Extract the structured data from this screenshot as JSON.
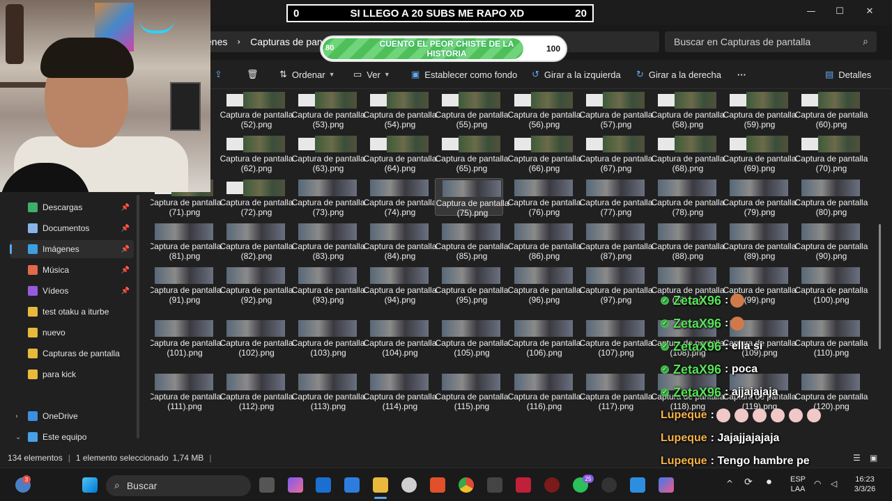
{
  "stream": {
    "goal_left": "0",
    "goal_text": "SI LLEGO A 20 SUBS ME RAPO XD",
    "goal_right": "20",
    "progress_start": "80",
    "progress_title": "CUENTO EL PEOR CHISTE DE LA HISTORIA",
    "progress_end": "100",
    "progress_fraction": 0.82,
    "chat": [
      {
        "user": "ZetaX96",
        "text": ":",
        "emote": true
      },
      {
        "user": "ZetaX96",
        "text": ":",
        "emote": true
      },
      {
        "user": "ZetaX96",
        "text": ": ella si",
        "emote": false
      },
      {
        "user": "ZetaX96",
        "text": ": poca",
        "emote": false
      },
      {
        "user": "ZetaX96",
        "text": ": ajjajajaja",
        "emote": false
      },
      {
        "user": "Lupeque",
        "text": ":",
        "emote": true
      },
      {
        "user": "Lupeque",
        "text": ": Jajajjajajaja",
        "emote": false
      },
      {
        "user": "Lupeque",
        "text": ": Tengo hambre pe",
        "emote": false
      }
    ]
  },
  "explorer": {
    "breadcrumb_prev": "enes",
    "breadcrumb_current": "Capturas de pan",
    "search_placeholder": "Buscar en Capturas de pantalla",
    "toolbar": {
      "sort": "Ordenar",
      "view": "Ver",
      "set_background": "Establecer como fondo",
      "rotate_left": "Girar a la izquierda",
      "rotate_right": "Girar a la derecha",
      "more": "···",
      "details": "Detalles"
    },
    "sidebar": [
      {
        "label": "Descargas",
        "pinned": true,
        "color": "#3fae6a"
      },
      {
        "label": "Documentos",
        "pinned": true,
        "color": "#8ab4e8"
      },
      {
        "label": "Imágenes",
        "pinned": true,
        "color": "#3d9ee0"
      },
      {
        "label": "Música",
        "pinned": true,
        "color": "#e06a4a"
      },
      {
        "label": "Vídeos",
        "pinned": true,
        "color": "#9a5ae0"
      },
      {
        "label": "test otaku a iturbe",
        "pinned": false,
        "color": "#e8b93c"
      },
      {
        "label": "nuevo",
        "pinned": false,
        "color": "#e8b93c"
      },
      {
        "label": "Capturas de pantalla",
        "pinned": false,
        "color": "#e8b93c"
      },
      {
        "label": "para kick",
        "pinned": false,
        "color": "#e8b93c"
      },
      {
        "label": "OneDrive",
        "pinned": false,
        "color": "#3d8ee0"
      },
      {
        "label": "Este equipo",
        "pinned": false,
        "color": "#4aa0e8"
      }
    ],
    "files": [
      "Captura de pantalla (52).png",
      "Captura de pantalla (53).png",
      "Captura de pantalla (54).png",
      "Captura de pantalla (55).png",
      "Captura de pantalla (56).png",
      "Captura de pantalla (57).png",
      "Captura de pantalla (58).png",
      "Captura de pantalla (59).png",
      "Captura de pantalla (60).png",
      "Captura de pantalla (62).png",
      "Captura de pantalla (63).png",
      "Captura de pantalla (64).png",
      "Captura de pantalla (65).png",
      "Captura de pantalla (66).png",
      "Captura de pantalla (67).png",
      "Captura de pantalla (68).png",
      "Captura de pantalla (69).png",
      "Captura de pantalla (70).png",
      "Captura de pantalla (71).png",
      "Captura de pantalla (72).png",
      "Captura de pantalla (73).png",
      "Captura de pantalla (74).png",
      "Captura de pantalla (75).png",
      "Captura de pantalla (76).png",
      "Captura de pantalla (77).png",
      "Captura de pantalla (78).png",
      "Captura de pantalla (79).png",
      "Captura de pantalla (80).png",
      "Captura de pantalla (81).png",
      "Captura de pantalla (82).png",
      "Captura de pantalla (83).png",
      "Captura de pantalla (84).png",
      "Captura de pantalla (85).png",
      "Captura de pantalla (86).png",
      "Captura de pantalla (87).png",
      "Captura de pantalla (88).png",
      "Captura de pantalla (89).png",
      "Captura de pantalla (90).png",
      "Captura de pantalla (91).png",
      "Captura de pantalla (92).png",
      "Captura de pantalla (93).png",
      "Captura de pantalla (94).png",
      "Captura de pantalla (95).png",
      "Captura de pantalla (96).png",
      "Captura de pantalla (97).png",
      "Captura de pantalla (98).png",
      "Captura de pantalla (99).png",
      "Captura de pantalla (100).png",
      "Captura de pantalla (101).png",
      "Captura de pantalla (102).png",
      "Captura de pantalla (103).png",
      "Captura de pantalla (104).png",
      "Captura de pantalla (105).png",
      "Captura de pantalla (106).png",
      "Captura de pantalla (107).png",
      "Captura de pantalla (108).png",
      "Captura de pantalla (109).png",
      "Captura de pantalla (110).png",
      "Captura de pantalla (111).png",
      "Captura de pantalla (112).png",
      "Captura de pantalla (113).png",
      "Captura de pantalla (114).png",
      "Captura de pantalla (115).png",
      "Captura de pantalla (116).png",
      "Captura de pantalla (117).png",
      "Captura de pantalla (118).png",
      "Captura de pantalla (119).png",
      "Captura de pantalla (120).png"
    ],
    "selected_file": "Captura de pantalla (75).png",
    "status": {
      "count": "134 elementos",
      "selection": "1 elemento seleccionado",
      "size": "1,74 MB"
    }
  },
  "taskbar": {
    "search_label": "Buscar",
    "notification_badge": "3",
    "whatsapp_badge": "25",
    "language": "ESP",
    "layout": "LAA",
    "time": "16:23",
    "date": "3/3/26"
  },
  "colors": {
    "accent": "#60a5e8",
    "chat_user_zeta": "#56e356",
    "chat_user_lupe": "#f7b44a",
    "progress_fill": "#4fbf5a"
  }
}
